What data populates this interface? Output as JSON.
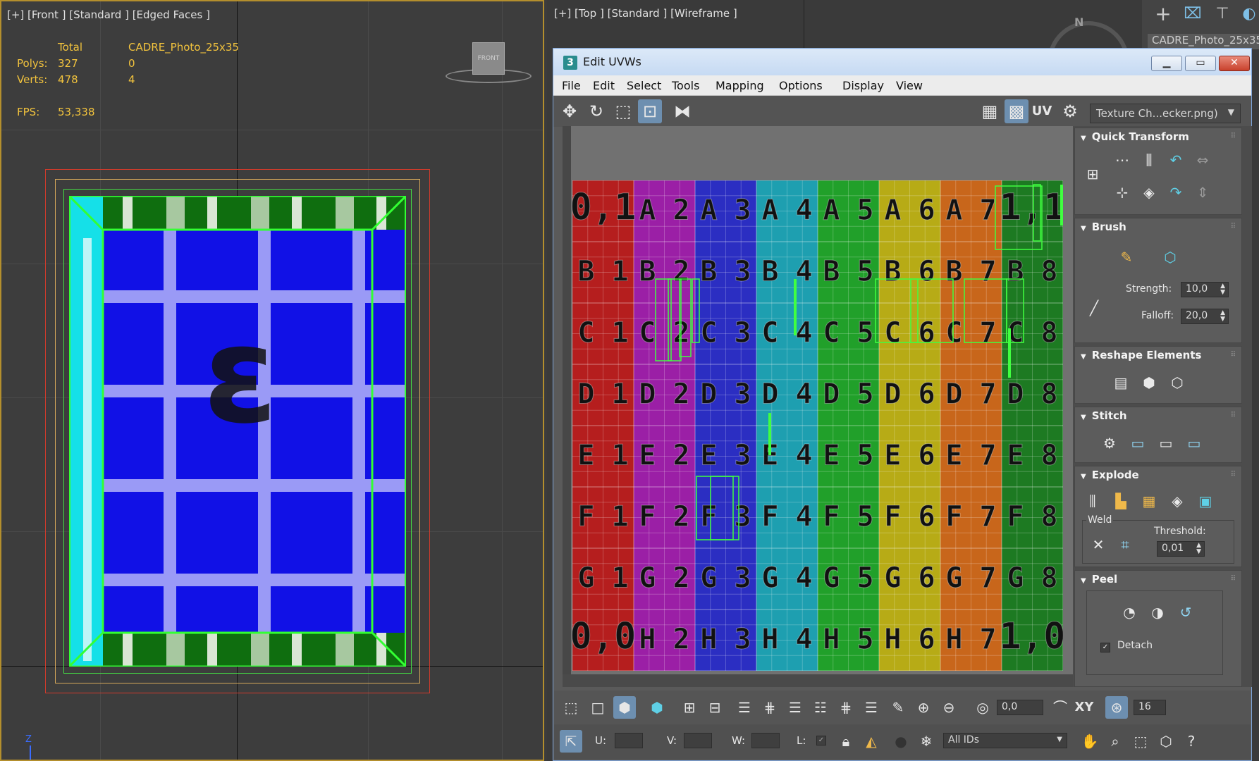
{
  "viewport_left": {
    "label": "[+] [Front ] [Standard ] [Edged Faces ]",
    "viewcube_label": "FRONT",
    "stats": {
      "col_total": "Total",
      "col_object": "CADRE_Photo_25x35",
      "polys_label": "Polys:",
      "polys_total": "327",
      "polys_object": "0",
      "verts_label": "Verts:",
      "verts_total": "478",
      "verts_object": "4",
      "fps_label": "FPS:",
      "fps_value": "53,338"
    },
    "axis_label": "Z"
  },
  "viewport_right": {
    "label": "[+] [Top ] [Standard ] [Wireframe ]",
    "compass_label": "N",
    "object_name_partial": "CADRE_Photo_25x35"
  },
  "edit_uvw": {
    "title": "Edit UVWs",
    "app_icon": "3",
    "menu": [
      "File",
      "Edit",
      "Select",
      "Tools",
      "Mapping",
      "Options",
      "Display",
      "View"
    ],
    "uv_label": "UV",
    "texture_dropdown": "Texture Ch...ecker.png)",
    "checker": {
      "rows": [
        [
          "0,1",
          "A 2",
          "A 3",
          "A 4",
          "A 5",
          "A 6",
          "A 7",
          "1,1"
        ],
        [
          "B 1",
          "B 2",
          "B 3",
          "B 4",
          "B 5",
          "B 6",
          "B 7",
          "B 8"
        ],
        [
          "C 1",
          "C 2",
          "C 3",
          "C 4",
          "C 5",
          "C 6",
          "C 7",
          "C 8"
        ],
        [
          "D 1",
          "D 2",
          "D 3",
          "D 4",
          "D 5",
          "D 6",
          "D 7",
          "D 8"
        ],
        [
          "E 1",
          "E 2",
          "E 3",
          "E 4",
          "E 5",
          "E 6",
          "E 7",
          "E 8"
        ],
        [
          "F 1",
          "F 2",
          "F 3",
          "F 4",
          "F 5",
          "F 6",
          "F 7",
          "F 8"
        ],
        [
          "G 1",
          "G 2",
          "G 3",
          "G 4",
          "G 5",
          "G 6",
          "G 7",
          "G 8"
        ],
        [
          "0,0",
          "H 2",
          "H 3",
          "H 4",
          "H 5",
          "H 6",
          "H 7",
          "1,0"
        ]
      ],
      "column_colors": [
        "#b51e1e",
        "#9b1fa6",
        "#2b2ec2",
        "#1e9fb0",
        "#21a02a",
        "#b7ab16",
        "#c8661b",
        "#1d7a22"
      ],
      "uv_wire_color": "#40ff40"
    },
    "rollouts": {
      "quick_transform": "Quick Transform",
      "brush": "Brush",
      "strength_label": "Strength:",
      "strength_value": "10,0",
      "falloff_label": "Falloff:",
      "falloff_value": "20,0",
      "reshape": "Reshape Elements",
      "stitch": "Stitch",
      "explode": "Explode",
      "weld": "Weld",
      "threshold_label": "Threshold:",
      "threshold_value": "0,01",
      "peel": "Peel",
      "detach_label": "Detach"
    },
    "bottom": {
      "soft_value": "0,0",
      "xy_label": "XY",
      "grid_value": "16",
      "u_label": "U:",
      "v_label": "V:",
      "w_label": "W:",
      "l_label": "L:",
      "ids_dropdown": "All IDs"
    }
  }
}
